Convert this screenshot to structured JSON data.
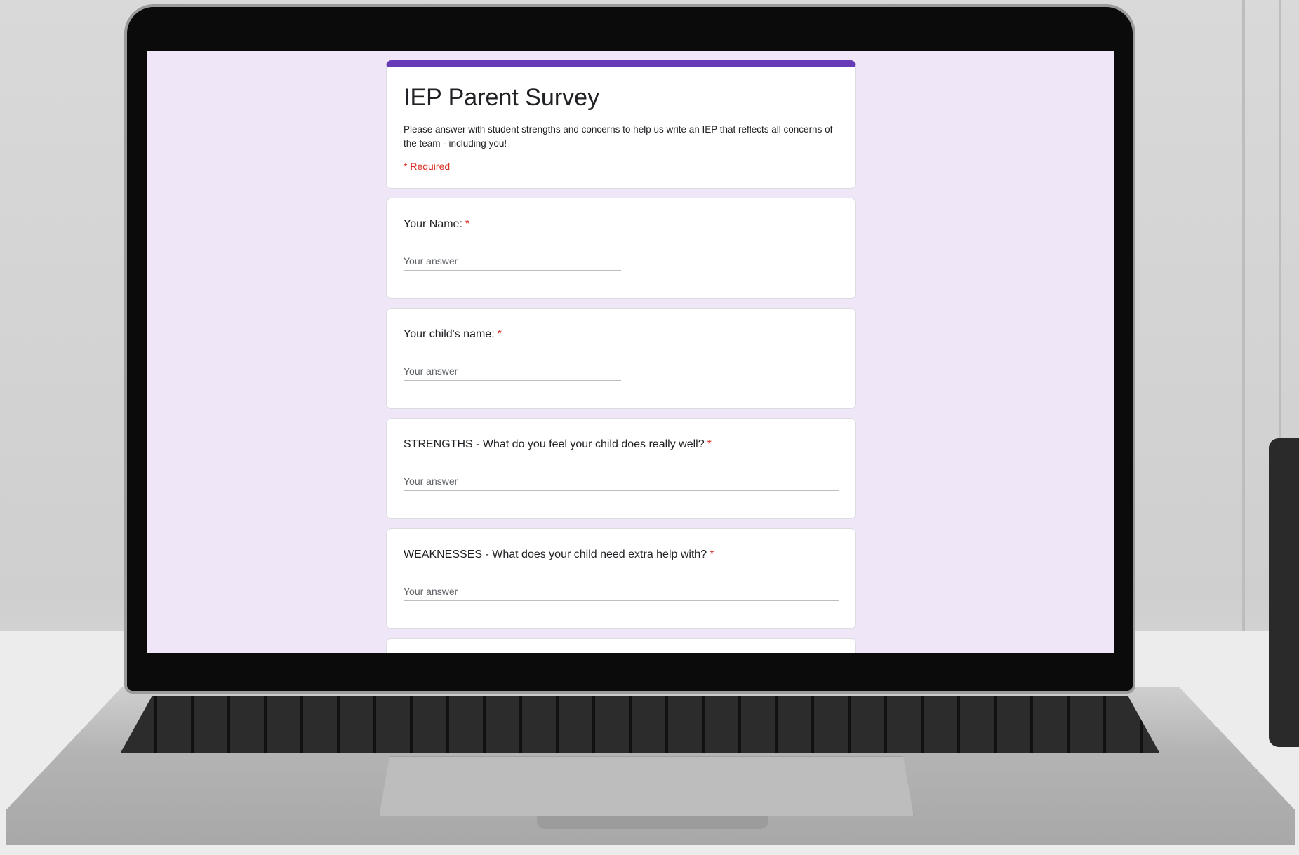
{
  "form": {
    "title": "IEP Parent Survey",
    "description": "Please answer with student strengths and concerns to help us write an IEP that reflects all concerns of the team - including you!",
    "required_note": "* Required",
    "accent_color": "#673ab7",
    "required_color": "#d93025",
    "background_color": "#efe6f7",
    "questions": [
      {
        "label": "Your Name:",
        "required_mark": "*",
        "placeholder": "Your answer"
      },
      {
        "label": "Your child's name:",
        "required_mark": "*",
        "placeholder": "Your answer"
      },
      {
        "label": "STRENGTHS - What do you feel your child does really well?",
        "required_mark": "*",
        "placeholder": "Your answer"
      },
      {
        "label": "WEAKNESSES - What does your child need extra help with?",
        "required_mark": "*",
        "placeholder": "Your answer"
      }
    ]
  }
}
